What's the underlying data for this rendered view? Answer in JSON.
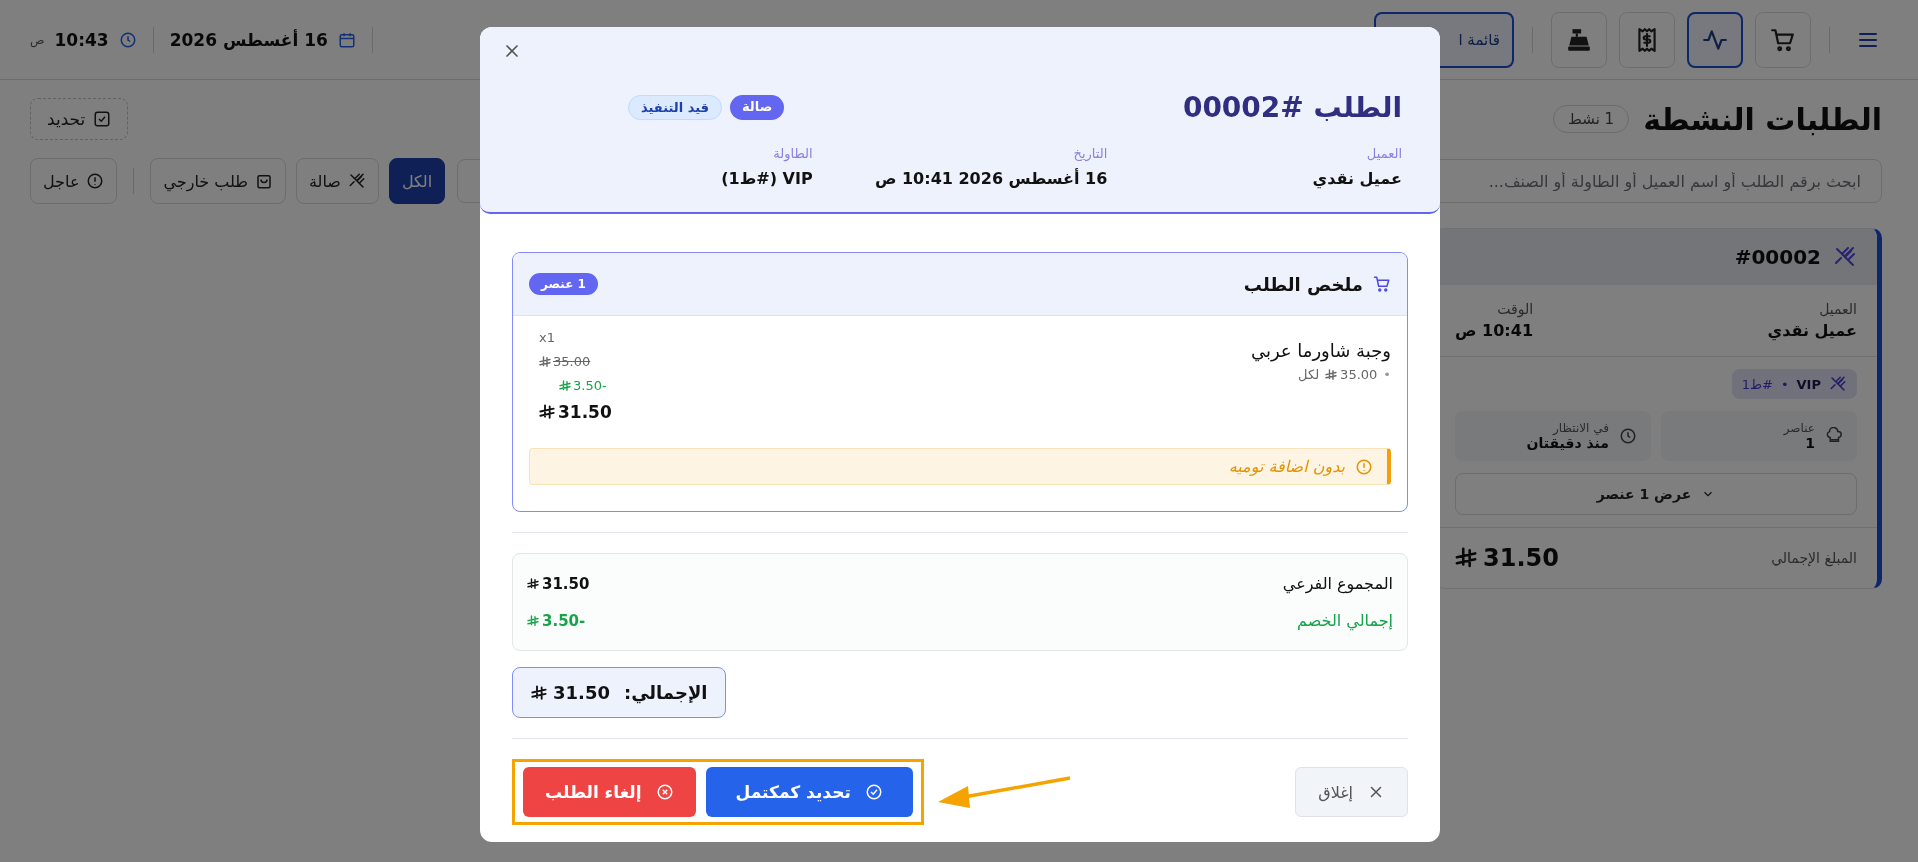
{
  "top_bar": {
    "menu_buttons": [
      {
        "label": "قائمة ا",
        "selected": true
      }
    ],
    "tool_buttons": [
      {
        "kind": "cart",
        "selected": false
      },
      {
        "kind": "activity",
        "selected": true
      },
      {
        "kind": "receipt",
        "selected": false
      },
      {
        "kind": "register",
        "selected": false
      }
    ],
    "date": "16 أغسطس 2026",
    "time": "10:43",
    "period": "ص"
  },
  "page": {
    "title": "الطلبات النشطة",
    "active_count": "1 نشط",
    "select_button": "تحديد",
    "search": {
      "placeholder": "ابحث برقم الطلب أو اسم العميل أو الطاولة أو الصنف..."
    },
    "filters": [
      {
        "label": "الكل",
        "kind": "all",
        "selected": true
      },
      {
        "label": "صالة",
        "kind": "dine_in",
        "selected": false
      },
      {
        "label": "طلب خارجي",
        "kind": "takeaway",
        "selected": false
      },
      {
        "label": "عاجل",
        "kind": "urgent",
        "selected": false
      }
    ]
  },
  "order_card": {
    "number": "#00002",
    "fields": [
      {
        "label": "العميل",
        "value": "عميل نقدي"
      },
      {
        "label": "الوقت",
        "value": "10:41 ص"
      }
    ],
    "tag": {
      "label": "VIP",
      "separator": "•",
      "table": "#ط1"
    },
    "stats": [
      {
        "kind": "items",
        "label": "عناصر",
        "value": "1"
      },
      {
        "kind": "waiting",
        "label": "في الانتظار",
        "value": "منذ دقيقتان"
      }
    ],
    "expand": "عرض 1 عنصر",
    "total_label": "المبلغ الإجمالي",
    "total": "31.50"
  },
  "modal": {
    "title": "الطلب #00002",
    "badges": [
      {
        "label": "صالة",
        "kind": "type"
      },
      {
        "label": "قيد التنفيذ",
        "kind": "status"
      }
    ],
    "info": [
      {
        "label": "العميل",
        "value": "عميل نقدي"
      },
      {
        "label": "التاريخ",
        "value": "16 أغسطس 2026 10:41 ص"
      },
      {
        "label": "الطاولة",
        "value": "VIP (#ط1)"
      }
    ],
    "summary": {
      "title": "ملخص الطلب",
      "count": "1 عنصر",
      "items": [
        {
          "name": "وجبة شاورما عربي",
          "bullet": "•",
          "unit_price": "35.00",
          "per": "لكل",
          "qty": "x1",
          "original": "35.00",
          "discount": "-3.50",
          "total": "31.50",
          "note": "بدون اضافة توميه"
        }
      ]
    },
    "totals": [
      {
        "label": "المجموع الفرعي",
        "value": "31.50",
        "kind": "normal"
      },
      {
        "label": "إجمالي الخصم",
        "value": "-3.50",
        "kind": "discount"
      }
    ],
    "grand_total": {
      "label": "الإجمالي:",
      "value": "31.50"
    },
    "buttons": {
      "close": "إغلاق",
      "complete": "تحديد كمكتمل",
      "cancel": "إلغاء الطلب"
    }
  }
}
